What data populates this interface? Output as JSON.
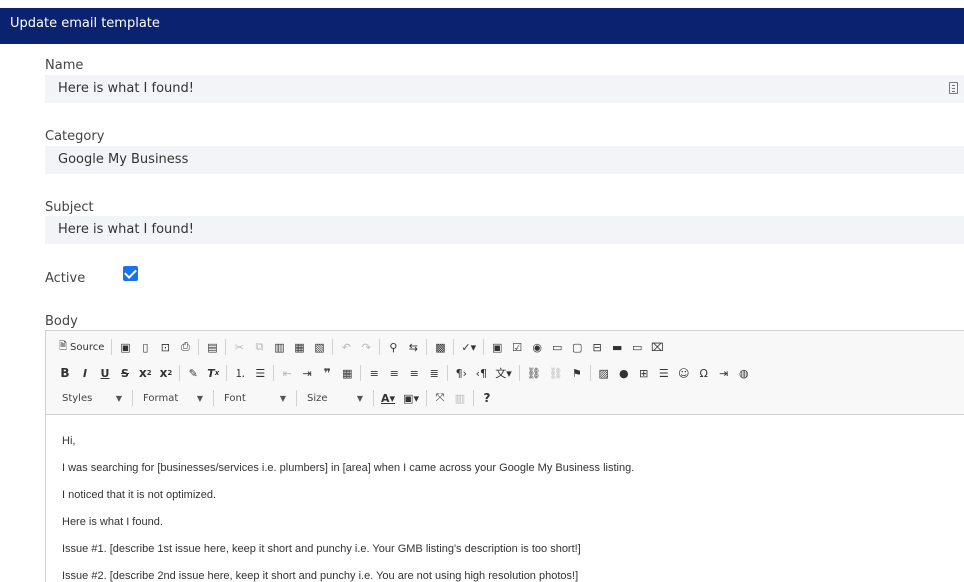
{
  "header": {
    "title": "Update email template"
  },
  "form": {
    "name_label": "Name",
    "name_value": "Here is what I found!",
    "category_label": "Category",
    "category_value": "Google My Business",
    "subject_label": "Subject",
    "subject_value": "Here is what I found!",
    "active_label": "Active",
    "active_checked": true,
    "body_label": "Body"
  },
  "toolbar": {
    "source_label": "Source",
    "styles_label": "Styles",
    "format_label": "Format",
    "font_label": "Font",
    "size_label": "Size"
  },
  "body_lines": [
    "Hi,",
    "I was searching for [businesses/services i.e. plumbers] in [area] when I came across your Google My Business listing.",
    "I noticed that it is not optimized.",
    "Here is what I found.",
    "Issue #1. [describe 1st issue here, keep it short and punchy i.e. Your GMB listing's description is too short!]",
    "Issue #2. [describe 2nd issue here, keep it short and punchy i.e. You are not using high resolution photos!]"
  ],
  "colors": {
    "header_bg": "#0b2270",
    "field_bg": "#f3f4f8",
    "checkbox": "#1a73e8"
  }
}
